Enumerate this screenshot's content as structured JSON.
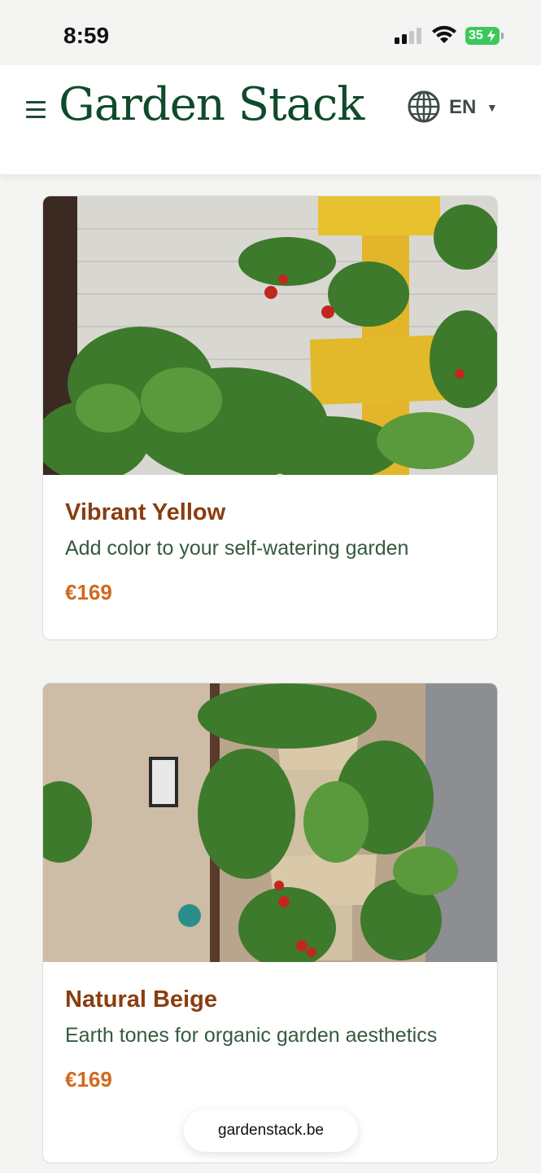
{
  "status_bar": {
    "time": "8:59",
    "battery_level": "35",
    "icons": [
      "signal-icon",
      "wifi-icon",
      "battery-icon"
    ]
  },
  "header": {
    "menu_icon": "hamburger-icon",
    "brand": "Garden Stack",
    "language_icon": "globe-icon",
    "language": "EN",
    "language_caret": "▼"
  },
  "products": [
    {
      "title": "Vibrant Yellow",
      "description": "Add color to your self-watering garden",
      "price": "€169",
      "accent_color": "#e8c22e"
    },
    {
      "title": "Natural Beige",
      "description": "Earth tones for organic garden aesthetics",
      "price": "€169",
      "accent_color": "#d9c9a8"
    }
  ],
  "browser": {
    "url": "gardenstack.be"
  },
  "colors": {
    "brand_green": "#0f4a2b",
    "title_brown": "#8a3d0f",
    "price_orange": "#d2691e",
    "text_green": "#355a40"
  }
}
